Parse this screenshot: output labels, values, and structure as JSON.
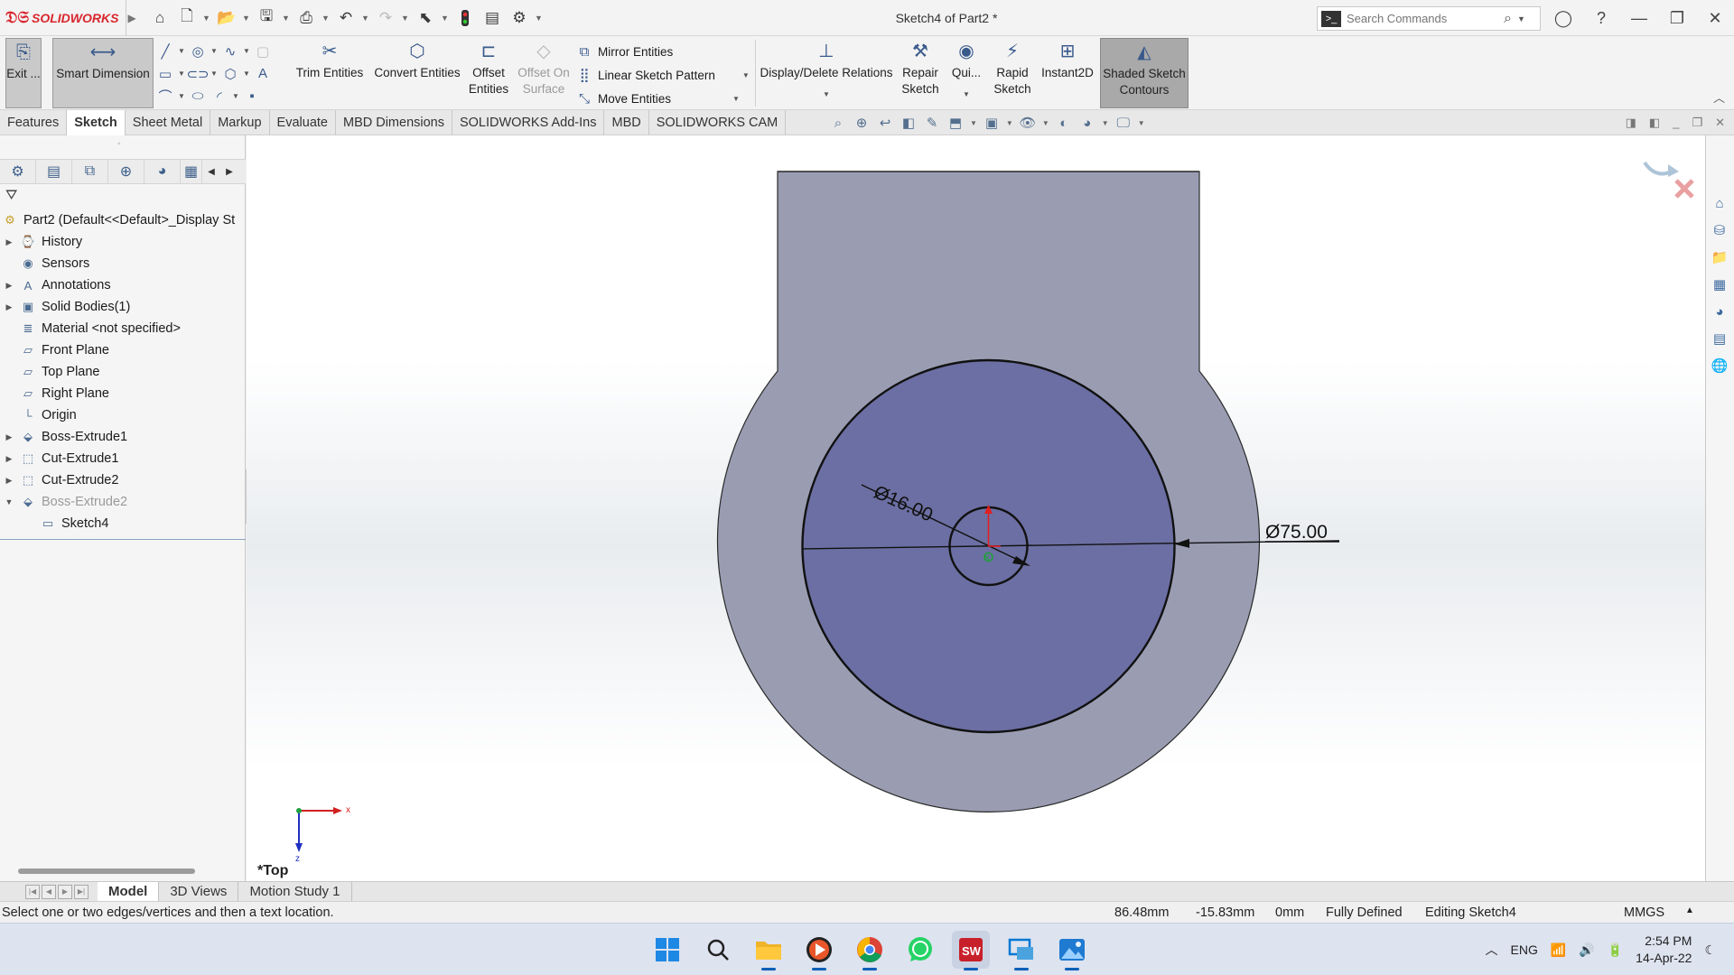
{
  "app": {
    "brand": "SOLIDWORKS",
    "document_title": "Sketch4 of Part2 *"
  },
  "search": {
    "placeholder": "Search Commands"
  },
  "ribbon": {
    "exit_label": "Exit ...",
    "smart_dimension": "Smart Dimension",
    "trim_entities": "Trim Entities",
    "convert_entities": "Convert Entities",
    "offset_entities": "Offset Entities",
    "offset_on_surface": "Offset On Surface",
    "mirror_entities": "Mirror Entities",
    "linear_sketch_pattern": "Linear Sketch Pattern",
    "move_entities": "Move Entities",
    "display_delete_relations": "Display/Delete Relations",
    "repair_sketch": "Repair Sketch",
    "quick_snaps": "Qui...",
    "rapid_sketch": "Rapid Sketch",
    "instant2d": "Instant2D",
    "shaded_sketch_contours": "Shaded Sketch Contours"
  },
  "tabs": [
    "Features",
    "Sketch",
    "Sheet Metal",
    "Markup",
    "Evaluate",
    "MBD Dimensions",
    "SOLIDWORKS Add-Ins",
    "MBD",
    "SOLIDWORKS CAM"
  ],
  "active_tab": "Sketch",
  "tree": {
    "root": "Part2  (Default<<Default>_Display St",
    "items": [
      {
        "label": "History",
        "icon": "history-icon",
        "expandable": true
      },
      {
        "label": "Sensors",
        "icon": "sensors-icon",
        "expandable": false
      },
      {
        "label": "Annotations",
        "icon": "annotations-icon",
        "expandable": true
      },
      {
        "label": "Solid Bodies(1)",
        "icon": "solid-bodies-icon",
        "expandable": true
      },
      {
        "label": "Material <not specified>",
        "icon": "material-icon",
        "expandable": false
      },
      {
        "label": "Front Plane",
        "icon": "plane-icon",
        "expandable": false
      },
      {
        "label": "Top Plane",
        "icon": "plane-icon",
        "expandable": false
      },
      {
        "label": "Right Plane",
        "icon": "plane-icon",
        "expandable": false
      },
      {
        "label": "Origin",
        "icon": "origin-icon",
        "expandable": false
      },
      {
        "label": "Boss-Extrude1",
        "icon": "extrude-icon",
        "expandable": true
      },
      {
        "label": "Cut-Extrude1",
        "icon": "cut-extrude-icon",
        "expandable": true
      },
      {
        "label": "Cut-Extrude2",
        "icon": "cut-extrude-icon",
        "expandable": true
      },
      {
        "label": "Boss-Extrude2",
        "icon": "extrude-icon",
        "expandable": true,
        "dimmed": true
      },
      {
        "label": "Sketch4",
        "icon": "sketch-icon",
        "child": true
      }
    ]
  },
  "viewport": {
    "view_label": "*Top",
    "dim_small": "Ø16.00",
    "dim_large": "Ø75.00",
    "triad_x": "x",
    "triad_z": "z",
    "colors": {
      "part_fill": "#9a9db2",
      "disk_fill": "#6c6fa3",
      "sketch_line": "#111111"
    }
  },
  "bottom_tabs": [
    "Model",
    "3D Views",
    "Motion Study 1"
  ],
  "active_bottom_tab": "Model",
  "status": {
    "message": "Select one or two edges/vertices and then a text location.",
    "x": "86.48mm",
    "y": "-15.83mm",
    "z": "0mm",
    "state": "Fully Defined",
    "editing": "Editing Sketch4",
    "units": "MMGS"
  },
  "taskbar": {
    "language": "ENG",
    "time": "2:54 PM",
    "date": "14-Apr-22"
  }
}
